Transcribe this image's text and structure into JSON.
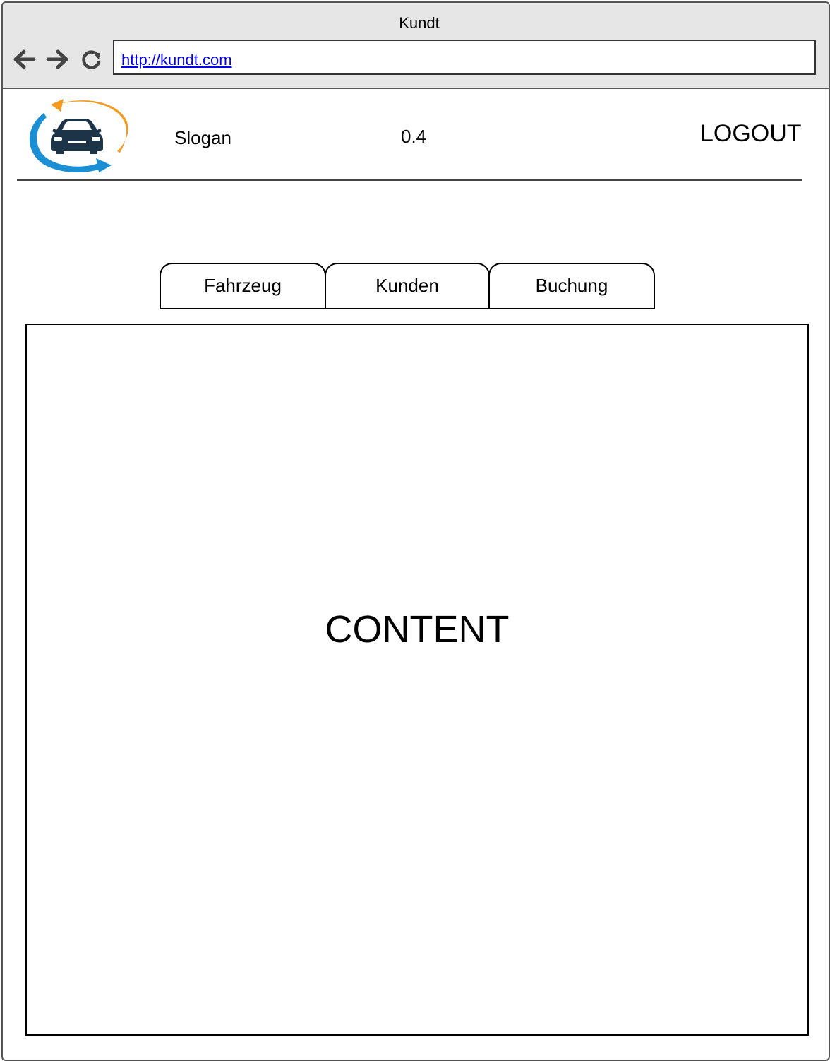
{
  "window": {
    "title": "Kundt"
  },
  "toolbar": {
    "back_icon": "arrow-left-icon",
    "forward_icon": "arrow-right-icon",
    "reload_icon": "reload-icon",
    "url": "http://kundt.com"
  },
  "header": {
    "logo": "car-logo",
    "slogan": "Slogan",
    "version": "0.4",
    "logout_label": "LOGOUT"
  },
  "tabs": [
    {
      "label": "Fahrzeug"
    },
    {
      "label": "Kunden"
    },
    {
      "label": "Buchung"
    }
  ],
  "main": {
    "content_label": "CONTENT"
  },
  "colors": {
    "logo_orange": "#f39a1f",
    "logo_blue": "#1a8fd3",
    "logo_car": "#1d3348",
    "chrome_bg": "#e6e6e6",
    "link": "#0000ee"
  }
}
